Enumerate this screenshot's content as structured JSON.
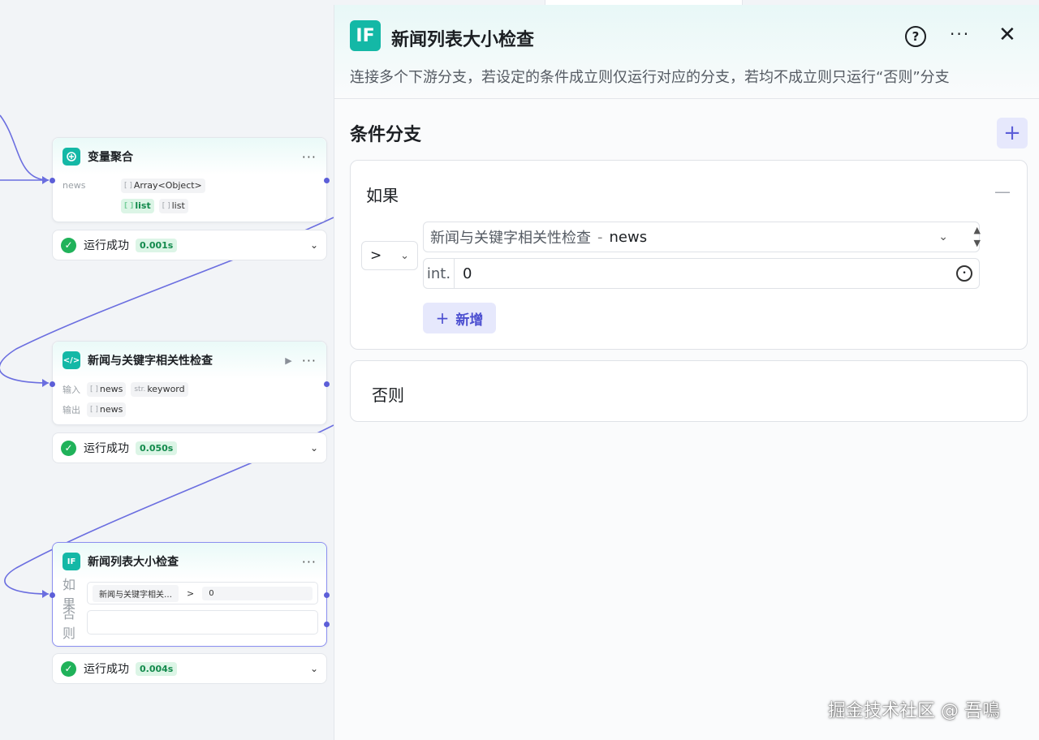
{
  "canvas": {
    "node_aggregate": {
      "title": "变量聚合",
      "icon": "variable-aggregate-icon",
      "output_label": "news",
      "output_type": "Array<Object>",
      "type_prefix": "[ ]",
      "vars": [
        {
          "name": "list",
          "highlighted": true
        },
        {
          "name": "list",
          "highlighted": false
        }
      ],
      "status": "运行成功",
      "time": "0.001s"
    },
    "node_relevance": {
      "title": "新闻与关键字相关性检查",
      "icon": "code-icon",
      "input_label": "输入",
      "output_label": "输出",
      "inputs": [
        {
          "prefix": "[ ]",
          "name": "news"
        },
        {
          "prefix": "str.",
          "name": "keyword"
        }
      ],
      "outputs": [
        {
          "prefix": "[ ]",
          "name": "news"
        }
      ],
      "status": "运行成功",
      "time": "0.050s"
    },
    "node_if": {
      "title": "新闻列表大小检查",
      "icon": "if-icon",
      "icon_text": "IF",
      "if_label": "如果",
      "else_label": "否则",
      "cond_var": "新闻与关键字相关…",
      "cond_op": ">",
      "cond_value": "0",
      "status": "运行成功",
      "time": "0.004s"
    },
    "accent_color": "#5c5ed8",
    "success_color": "#20b25a"
  },
  "panel": {
    "icon_text": "IF",
    "title": "新闻列表大小检查",
    "description": "连接多个下游分支，若设定的条件成立则仅运行对应的分支，若均不成立则只运行“否则”分支",
    "section_title": "条件分支",
    "if_label": "如果",
    "operator": ">",
    "variable_node": "新闻与关键字相关性检查",
    "variable_sep": "-",
    "variable_key": "news",
    "value_type": "int.",
    "value": "0",
    "add_condition_label": "新增",
    "else_label": "否则"
  },
  "watermark": "掘金技术社区 @ 吾鳴"
}
